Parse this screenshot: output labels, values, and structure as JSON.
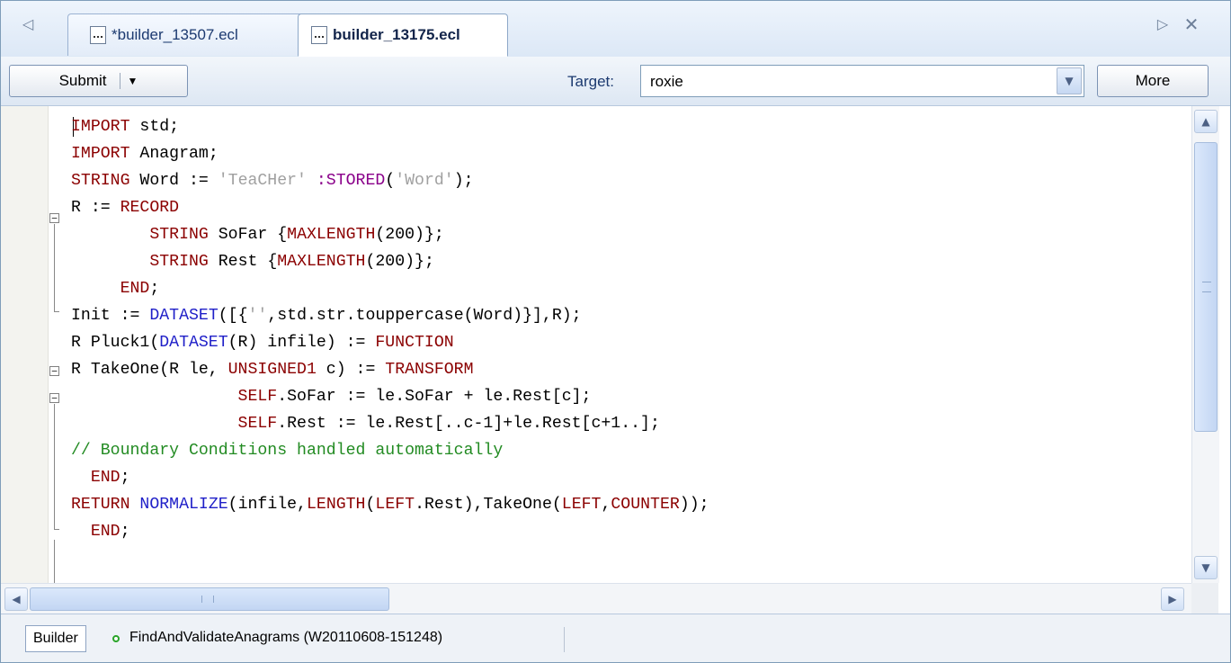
{
  "tabs": [
    {
      "label": "*builder_13507.ecl",
      "active": false
    },
    {
      "label": "builder_13175.ecl",
      "active": true
    }
  ],
  "toolbar": {
    "submit_label": "Submit",
    "target_label": "Target:",
    "target_value": "roxie",
    "more_label": "More"
  },
  "editor": {
    "lines": [
      [
        "IMPORT",
        " std;"
      ],
      [
        "IMPORT",
        " Anagram;"
      ],
      [
        "STRING",
        " Word := ",
        "'TeaCHer'",
        " :STORED",
        "(",
        "'Word'",
        ");"
      ],
      [
        "R := ",
        "RECORD"
      ],
      [
        "        ",
        "STRING",
        " SoFar {",
        "MAXLENGTH",
        "(200)};"
      ],
      [
        "        ",
        "STRING",
        " Rest {",
        "MAXLENGTH",
        "(200)};"
      ],
      [
        "     ",
        "END",
        ";"
      ],
      [
        "Init := ",
        "DATASET",
        "([{",
        "''",
        ",std.str.touppercase(Word)}],R);"
      ],
      [
        "R Pluck1(",
        "DATASET",
        "(R) infile) := ",
        "FUNCTION"
      ],
      [
        "R TakeOne(R le, ",
        "UNSIGNED1",
        " c) := ",
        "TRANSFORM"
      ],
      [
        "                 ",
        "SELF",
        ".SoFar := le.SoFar + le.Rest[c];"
      ],
      [
        "                 ",
        "SELF",
        ".Rest := le.Rest[..c-1]+le.Rest[c+1..];"
      ],
      [
        "// Boundary Conditions handled automatically"
      ],
      [
        "  ",
        "END",
        ";"
      ],
      [
        "RETURN",
        " ",
        "NORMALIZE",
        "(infile,",
        "LENGTH",
        "(",
        "LEFT",
        ".Rest),TakeOne(",
        "LEFT",
        ",",
        "COUNTER",
        "));"
      ],
      [
        "  ",
        "END",
        ";"
      ]
    ],
    "token_styles": [
      [
        "kw",
        "plain"
      ],
      [
        "kw",
        "plain"
      ],
      [
        "kw",
        "plain",
        "str",
        "pur",
        "plain",
        "str",
        "plain"
      ],
      [
        "plain",
        "kw"
      ],
      [
        "plain",
        "kw",
        "plain",
        "kw",
        "plain"
      ],
      [
        "plain",
        "kw",
        "plain",
        "kw",
        "plain"
      ],
      [
        "plain",
        "kw",
        "plain"
      ],
      [
        "plain",
        "fn",
        "plain",
        "str",
        "plain"
      ],
      [
        "plain",
        "fn",
        "plain",
        "kw"
      ],
      [
        "plain",
        "kw",
        "plain",
        "kw"
      ],
      [
        "plain",
        "kw",
        "plain"
      ],
      [
        "plain",
        "kw",
        "plain"
      ],
      [
        "cmt"
      ],
      [
        "plain",
        "kw",
        "plain"
      ],
      [
        "kw",
        "plain",
        "fn",
        "plain",
        "kw",
        "plain",
        "kw",
        "plain",
        "kw",
        "plain",
        "kw",
        "plain"
      ],
      [
        "plain",
        "kw",
        "plain"
      ]
    ]
  },
  "statusbar": {
    "builder_tab": "Builder",
    "workunit": "FindAndValidateAnagrams (W20110608-151248)"
  },
  "icons": {
    "tab_scroll_left": "◁",
    "tab_scroll_right": "▷",
    "close": "✕",
    "dropdown": "▼",
    "scroll_up": "▲",
    "scroll_down": "▼",
    "scroll_left": "◀",
    "scroll_right": "▶",
    "fold_collapse": "−"
  },
  "colors": {
    "keyword": "#8b0000",
    "function": "#1f1fc8",
    "string": "#a0a0a0",
    "stored": "#8a008a",
    "comment": "#228b22"
  }
}
